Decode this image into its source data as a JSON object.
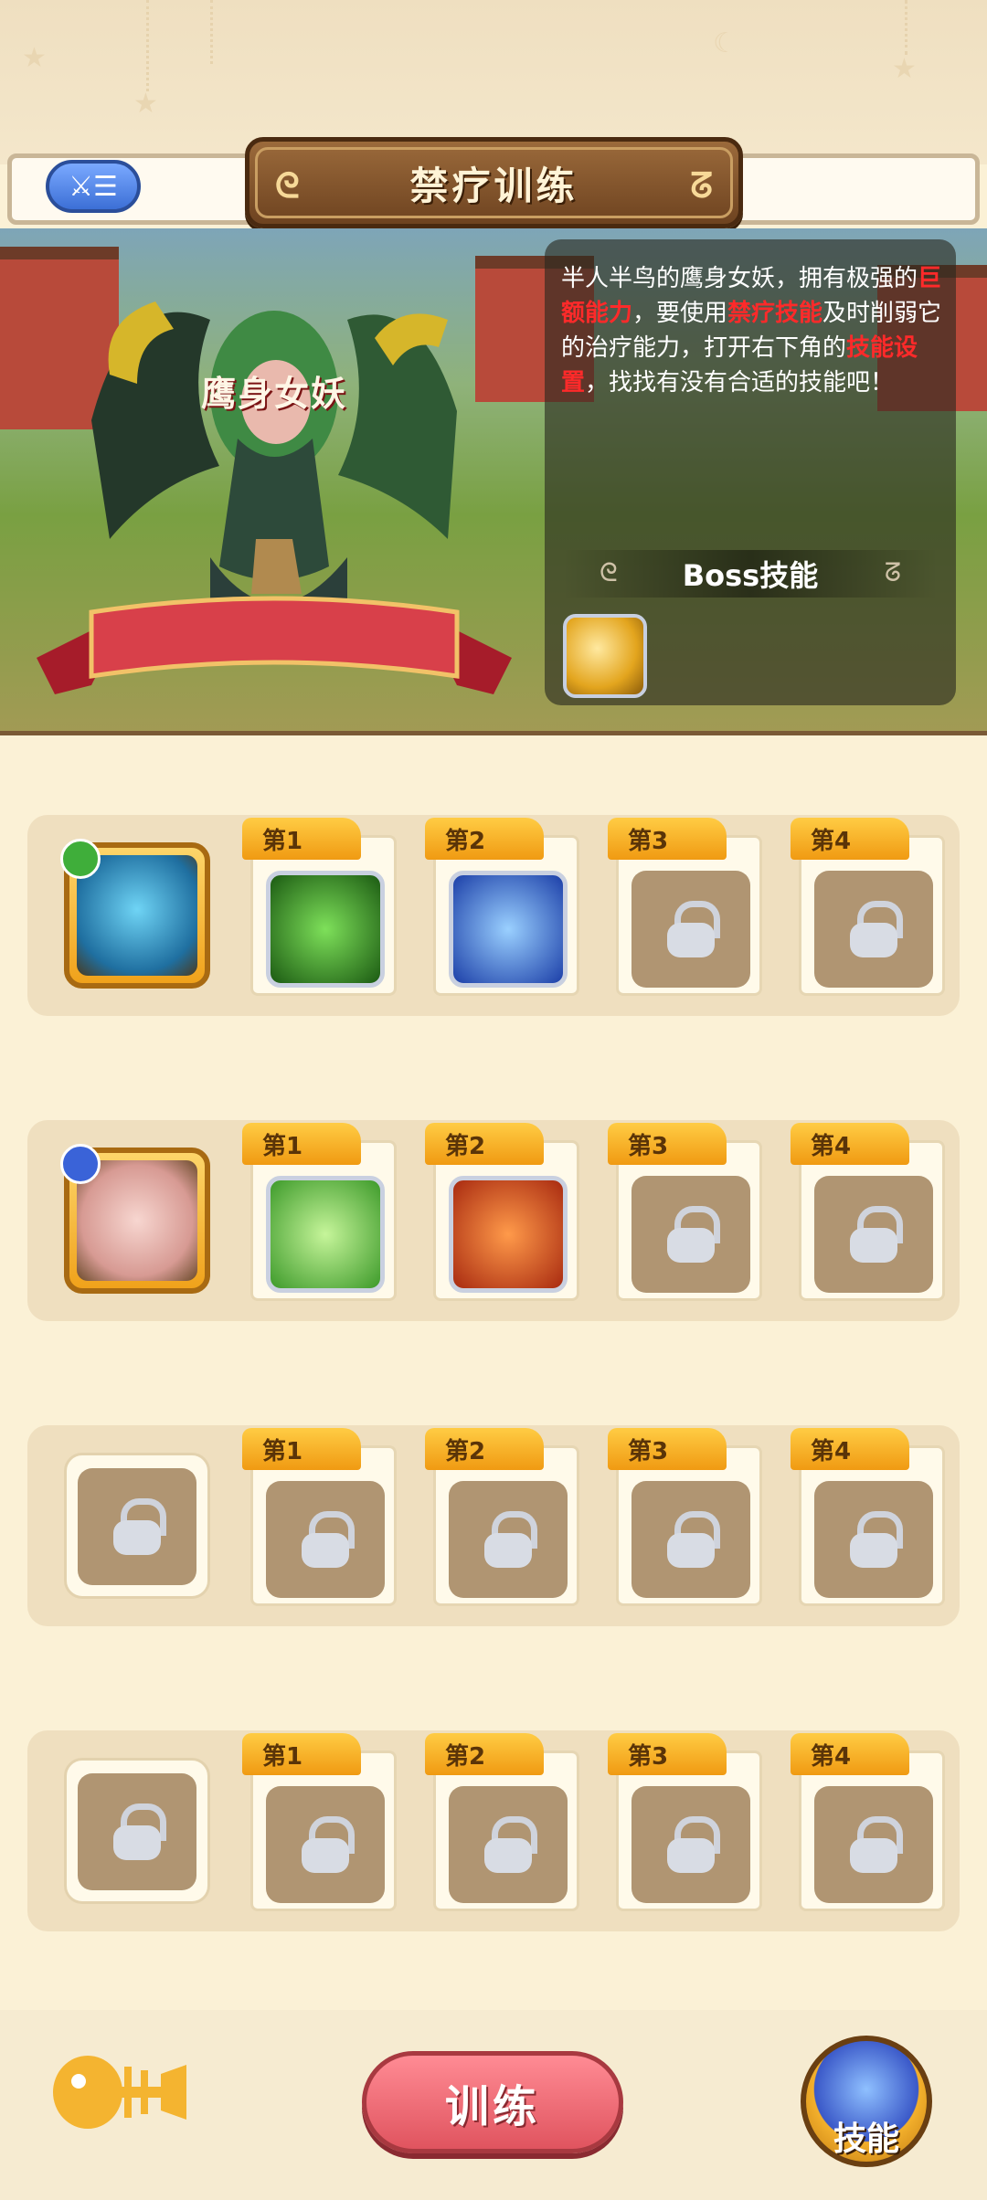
{
  "header": {
    "title": "禁疗训练",
    "list_icon": "list-icon"
  },
  "boss": {
    "name": "鹰身女妖",
    "description_parts": [
      {
        "text": "半人半鸟的鹰身女妖，拥有极强的",
        "hl": false
      },
      {
        "text": "巨额能力",
        "hl": true
      },
      {
        "text": "，要使用",
        "hl": false
      },
      {
        "text": "禁疗技能",
        "hl": true
      },
      {
        "text": "及时削弱它的治疗能力，打开右下角的",
        "hl": false
      },
      {
        "text": "技能设置",
        "hl": true
      },
      {
        "text": "，找找有没有合适的技能吧！",
        "hl": false
      }
    ],
    "skills_label": "Boss技能",
    "skill_icon": "golden-wing-icon",
    "highlight_color": "#ff2a2a"
  },
  "rows": [
    {
      "hero": {
        "present": true,
        "icon": "blue-fish-hero-icon",
        "badge": "bow-badge-icon"
      },
      "slots": [
        {
          "label": "第1",
          "locked": false,
          "icon": "green-spear-skill-icon"
        },
        {
          "label": "第2",
          "locked": false,
          "icon": "blue-hand-skill-icon"
        },
        {
          "label": "第3",
          "locked": true
        },
        {
          "label": "第4",
          "locked": true
        }
      ]
    },
    {
      "hero": {
        "present": true,
        "icon": "pink-pig-hero-icon",
        "badge": "gem-badge-icon"
      },
      "slots": [
        {
          "label": "第1",
          "locked": false,
          "icon": "green-heal-hand-skill-icon"
        },
        {
          "label": "第2",
          "locked": false,
          "icon": "red-fist-skill-icon"
        },
        {
          "label": "第3",
          "locked": true
        },
        {
          "label": "第4",
          "locked": true
        }
      ]
    },
    {
      "hero": {
        "present": false
      },
      "slots": [
        {
          "label": "第1",
          "locked": true
        },
        {
          "label": "第2",
          "locked": true
        },
        {
          "label": "第3",
          "locked": true
        },
        {
          "label": "第4",
          "locked": true
        }
      ]
    },
    {
      "hero": {
        "present": false
      },
      "slots": [
        {
          "label": "第1",
          "locked": true
        },
        {
          "label": "第2",
          "locked": true
        },
        {
          "label": "第3",
          "locked": true
        },
        {
          "label": "第4",
          "locked": true
        }
      ]
    }
  ],
  "bottom": {
    "train_label": "训练",
    "skill_label": "技能",
    "fish_icon": "fishbone-icon"
  }
}
